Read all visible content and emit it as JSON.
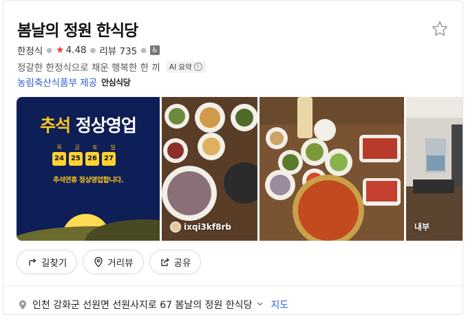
{
  "place": {
    "name": "봄날의 정원 한식당",
    "category": "한정식",
    "rating": "4.48",
    "reviews_label": "리뷰 735",
    "description": "정갈한 한정식으로 채운 행복한 한 끼",
    "ai_badge": "AI 요약",
    "provider_link": "농림축산식품부 제공",
    "provider_brand": "안심식당"
  },
  "photos": {
    "promo": {
      "title_highlight": "추석",
      "title_rest": "정상영업",
      "day_labels": [
        "목",
        "금",
        "토",
        "일"
      ],
      "days": [
        "24",
        "25",
        "26",
        "27"
      ],
      "subtitle": "추석연휴 정상영업합니다."
    },
    "photo2_label": "ixqi3kf8rb",
    "photo4_label": "내부"
  },
  "actions": {
    "directions": "길찾기",
    "street_view": "거리뷰",
    "share": "공유"
  },
  "address": {
    "text": "인천 강화군 선원면 선원사지로 67 봄날의 정원 한식당",
    "map_link": "지도"
  },
  "colors": {
    "link": "#2a5bd7",
    "rating_star": "#f23a3c",
    "promo_bg": "#0e1e56",
    "promo_yellow": "#ffc51b"
  },
  "icons": [
    "star-outline-icon",
    "rating-star-icon",
    "accessibility-icon",
    "info-icon",
    "directions-icon",
    "location-icon",
    "share-icon",
    "map-pin-icon",
    "chevron-down-icon"
  ]
}
